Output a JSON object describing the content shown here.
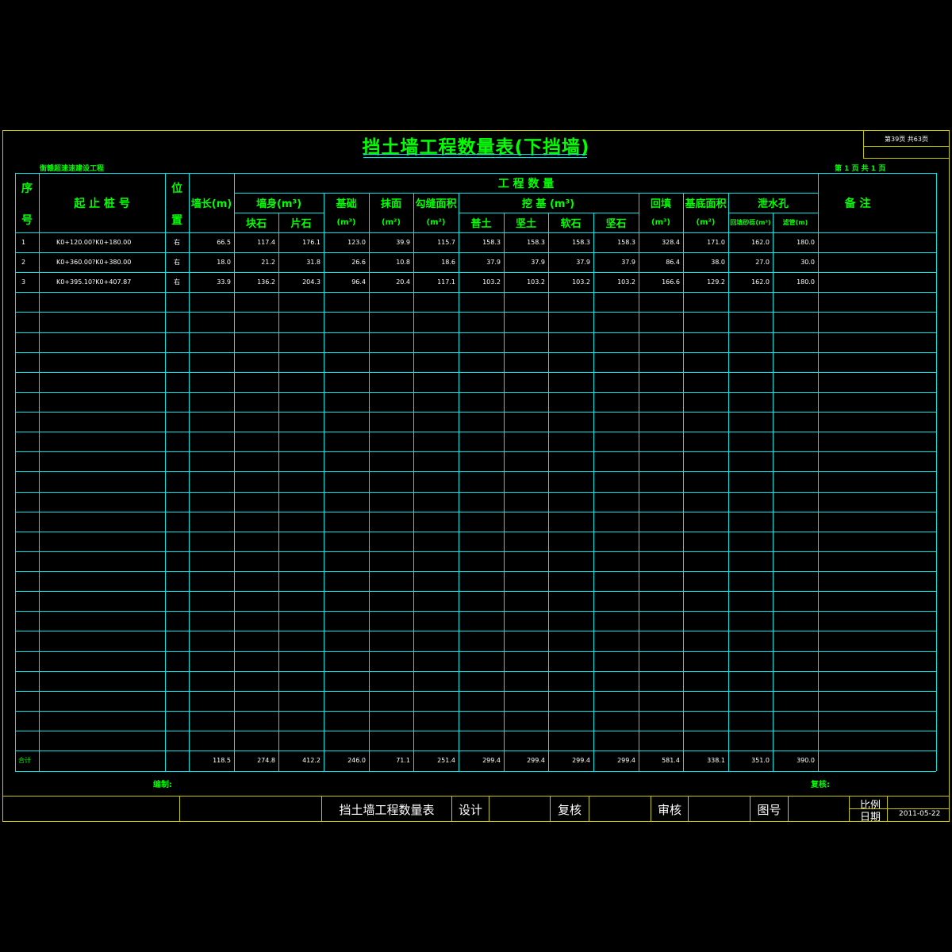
{
  "title": "挡土墙工程数量表(下挡墙)",
  "page_indicator": "第39页  共63页",
  "project_name": "衡赣超速速建设工程",
  "sheet_indicator": "第 1 页   共 1 页",
  "headers": {
    "seq_1": "序",
    "seq_2": "号",
    "stake": "起 止 桩 号",
    "pos_1": "位",
    "pos_2": "置",
    "length": "墙长(m)",
    "quantity": "工    程    数    量",
    "wall_body": "墙身(m³)",
    "block_stone": "块石",
    "rubble": "片石",
    "foundation": "基础",
    "foundation_unit": "(m³)",
    "plaster": "抹面",
    "plaster_unit": "(m²)",
    "joint": "勾缝面积",
    "joint_unit": "(m²)",
    "excavation": "挖    基  (m³)",
    "soil_common": "普土",
    "soil_hard": "坚土",
    "rock_soft": "软石",
    "rock_hard": "坚石",
    "backfill": "回填",
    "backfill_unit": "(m³)",
    "base_area": "基底面积",
    "base_area_unit": "(m²)",
    "drain": "泄水孔",
    "drain_sub1": "回填砂砾(m³)",
    "drain_sub2": "滤管(m)",
    "remark": "备    注"
  },
  "rows": [
    {
      "seq": "1",
      "stake": "K0+120.00?K0+180.00",
      "pos": "右",
      "length": "66.5",
      "block": "117.4",
      "rubble": "176.1",
      "foundation": "123.0",
      "plaster": "39.9",
      "joint": "115.7",
      "soil1": "158.3",
      "soil2": "158.3",
      "rock1": "158.3",
      "rock2": "158.3",
      "backfill": "328.4",
      "base": "171.0",
      "drain1": "162.0",
      "drain2": "180.0"
    },
    {
      "seq": "2",
      "stake": "K0+360.00?K0+380.00",
      "pos": "右",
      "length": "18.0",
      "block": "21.2",
      "rubble": "31.8",
      "foundation": "26.6",
      "plaster": "10.8",
      "joint": "18.6",
      "soil1": "37.9",
      "soil2": "37.9",
      "rock1": "37.9",
      "rock2": "37.9",
      "backfill": "86.4",
      "base": "38.0",
      "drain1": "27.0",
      "drain2": "30.0"
    },
    {
      "seq": "3",
      "stake": "K0+395.10?K0+407.87",
      "pos": "右",
      "length": "33.9",
      "block": "136.2",
      "rubble": "204.3",
      "foundation": "96.4",
      "plaster": "20.4",
      "joint": "117.1",
      "soil1": "103.2",
      "soil2": "103.2",
      "rock1": "103.2",
      "rock2": "103.2",
      "backfill": "166.6",
      "base": "129.2",
      "drain1": "162.0",
      "drain2": "180.0"
    }
  ],
  "total": {
    "seq": "合计",
    "length": "118.5",
    "block": "274.8",
    "rubble": "412.2",
    "foundation": "246.0",
    "plaster": "71.1",
    "joint": "251.4",
    "soil1": "299.4",
    "soil2": "299.4",
    "rock1": "299.4",
    "rock2": "299.4",
    "backfill": "581.4",
    "base": "338.1",
    "drain1": "351.0",
    "drain2": "390.0"
  },
  "sign": {
    "compile": "编制:",
    "review": "复核:"
  },
  "title_block": {
    "drawing_name": "挡土墙工程数量表",
    "design": "设计",
    "recheck": "复核",
    "audit": "审核",
    "drawing_no": "图号",
    "scale": "比例",
    "date_label": "日期",
    "date": "2011-05-22"
  }
}
